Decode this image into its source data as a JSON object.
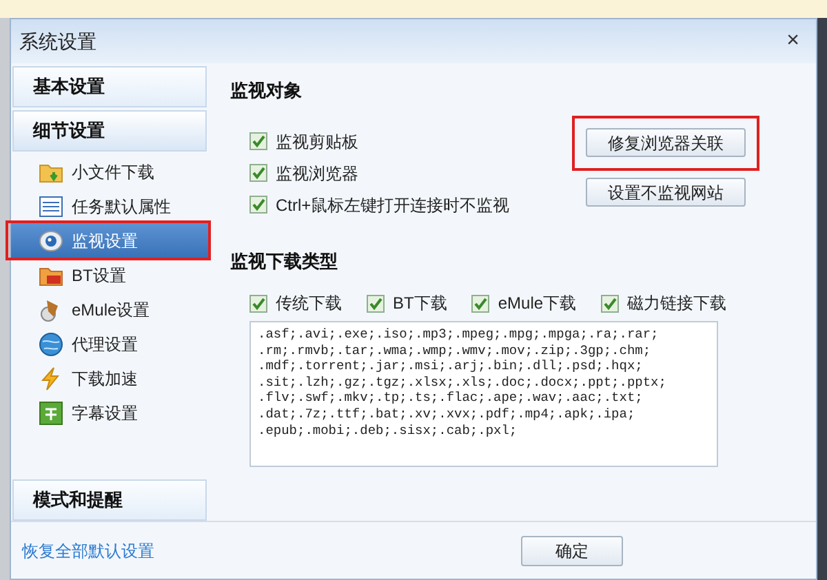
{
  "window": {
    "title": "系统设置",
    "close": "×"
  },
  "sidebar": {
    "sections": [
      {
        "label": "基本设置",
        "selected": false
      },
      {
        "label": "细节设置",
        "selected": true
      }
    ],
    "items": [
      {
        "label": "小文件下载",
        "kind": "folder",
        "selected": false,
        "highlighted": false
      },
      {
        "label": "任务默认属性",
        "kind": "list",
        "selected": false,
        "highlighted": false
      },
      {
        "label": "监视设置",
        "kind": "eye",
        "selected": true,
        "highlighted": true
      },
      {
        "label": "BT设置",
        "kind": "bt",
        "selected": false,
        "highlighted": false
      },
      {
        "label": "eMule设置",
        "kind": "mule",
        "selected": false,
        "highlighted": false
      },
      {
        "label": "代理设置",
        "kind": "globe",
        "selected": false,
        "highlighted": false
      },
      {
        "label": "下载加速",
        "kind": "bolt",
        "selected": false,
        "highlighted": false
      },
      {
        "label": "字幕设置",
        "kind": "subtitle",
        "selected": false,
        "highlighted": false
      }
    ],
    "bottom_section": {
      "label": "模式和提醒",
      "selected": false
    }
  },
  "monitor_targets": {
    "title": "监视对象",
    "options": [
      {
        "label": "监视剪贴板",
        "checked": true
      },
      {
        "label": "监视浏览器",
        "checked": true
      },
      {
        "label": "Ctrl+鼠标左键打开连接时不监视",
        "checked": true
      }
    ],
    "buttons": [
      {
        "label": "修复浏览器关联",
        "highlighted": true
      },
      {
        "label": "设置不监视网站",
        "highlighted": false
      }
    ]
  },
  "monitor_types": {
    "title": "监视下载类型",
    "options": [
      {
        "label": "传统下载",
        "checked": true
      },
      {
        "label": "BT下载",
        "checked": true
      },
      {
        "label": "eMule下载",
        "checked": true
      },
      {
        "label": "磁力链接下载",
        "checked": true
      }
    ],
    "extensions": [
      ".asf;.avi;.exe;.iso;.mp3;.mpeg;.mpg;.mpga;.ra;.rar;",
      ".rm;.rmvb;.tar;.wma;.wmp;.wmv;.mov;.zip;.3gp;.chm;",
      ".mdf;.torrent;.jar;.msi;.arj;.bin;.dll;.psd;.hqx;",
      ".sit;.lzh;.gz;.tgz;.xlsx;.xls;.doc;.docx;.ppt;.pptx;",
      ".flv;.swf;.mkv;.tp;.ts;.flac;.ape;.wav;.aac;.txt;",
      ".dat;.7z;.ttf;.bat;.xv;.xvx;.pdf;.mp4;.apk;.ipa;",
      ".epub;.mobi;.deb;.sisx;.cab;.pxl;"
    ]
  },
  "footer": {
    "restore_link": "恢复全部默认设置",
    "ok_button": "确定"
  }
}
